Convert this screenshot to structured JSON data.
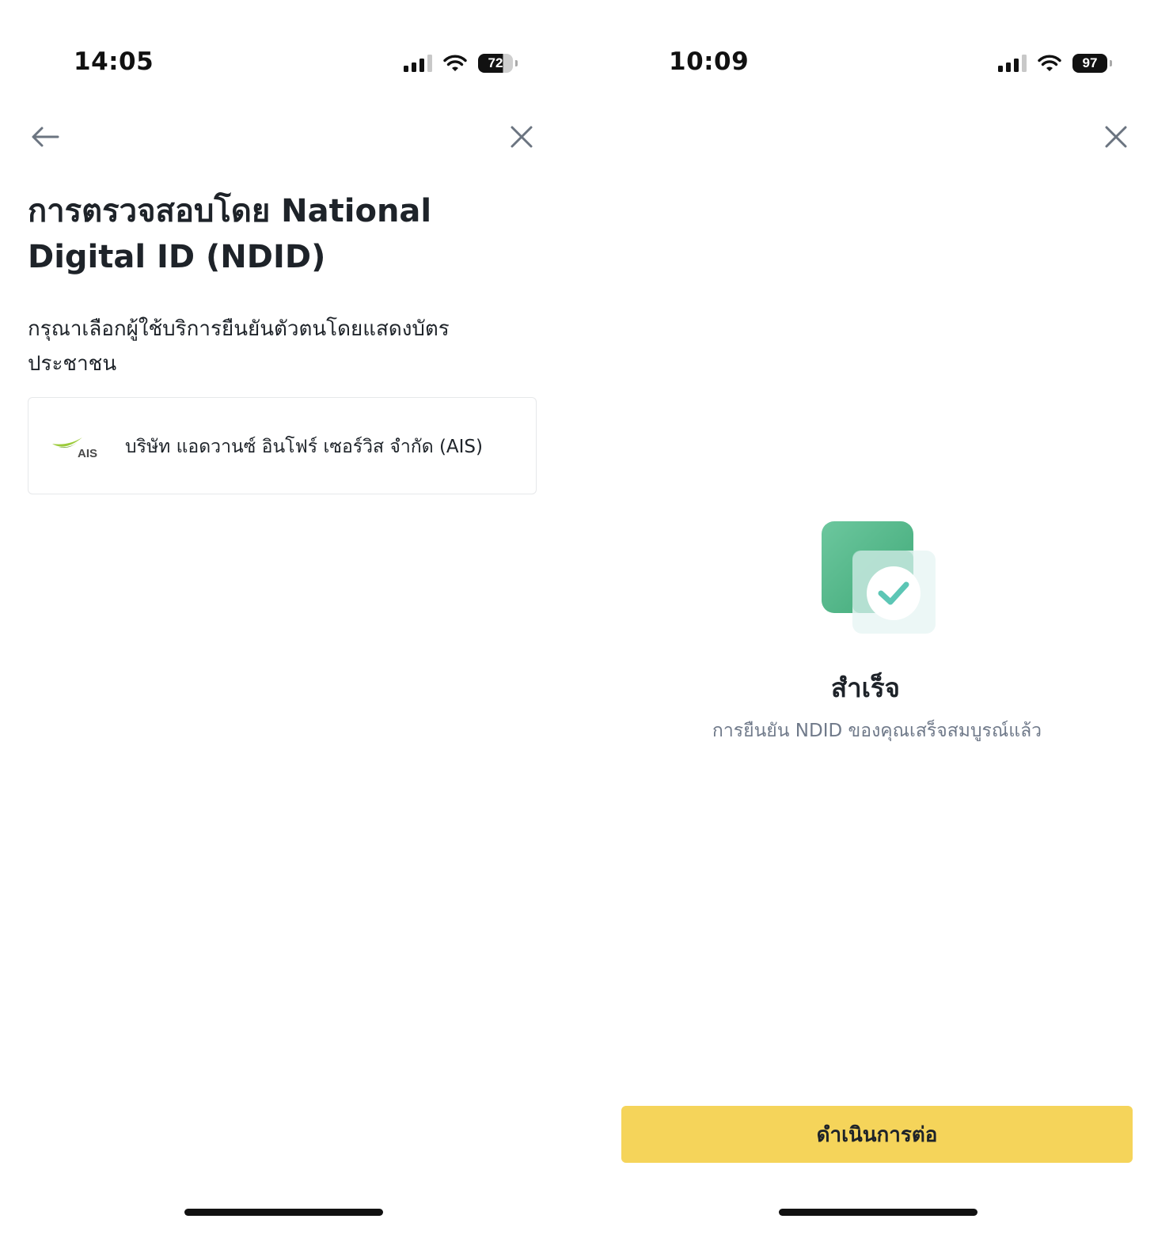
{
  "left_screen": {
    "status_bar": {
      "time": "14:05",
      "battery_level": "72"
    },
    "nav": {
      "back_icon": "arrow-left-icon",
      "close_icon": "close-icon"
    },
    "title": "การตรวจสอบโดย National Digital ID (NDID)",
    "subtitle": "กรุณาเลือกผู้ใช้บริการยืนยันตัวตนโดยแสดงบัตรประชาชน",
    "providers": [
      {
        "logo_text": "AIS",
        "name": "บริษัท แอดวานซ์ อินโฟร์ เซอร์วิส จำกัด (AIS)"
      }
    ]
  },
  "right_screen": {
    "status_bar": {
      "time": "10:09",
      "battery_level": "97"
    },
    "nav": {
      "close_icon": "close-icon"
    },
    "illustration": "success-check-icon",
    "success_title": "สำเร็จ",
    "success_message": "การยืนยัน NDID ของคุณเสร็จสมบูรณ์แล้ว",
    "continue_label": "ดำเนินการต่อ"
  },
  "colors": {
    "primary_button": "#f5d45a",
    "text_primary": "#1e2329",
    "text_secondary": "#707a8a",
    "success_green": "#4fb58a",
    "check_teal": "#5cc6b5",
    "ais_green": "#9ccb3b"
  }
}
